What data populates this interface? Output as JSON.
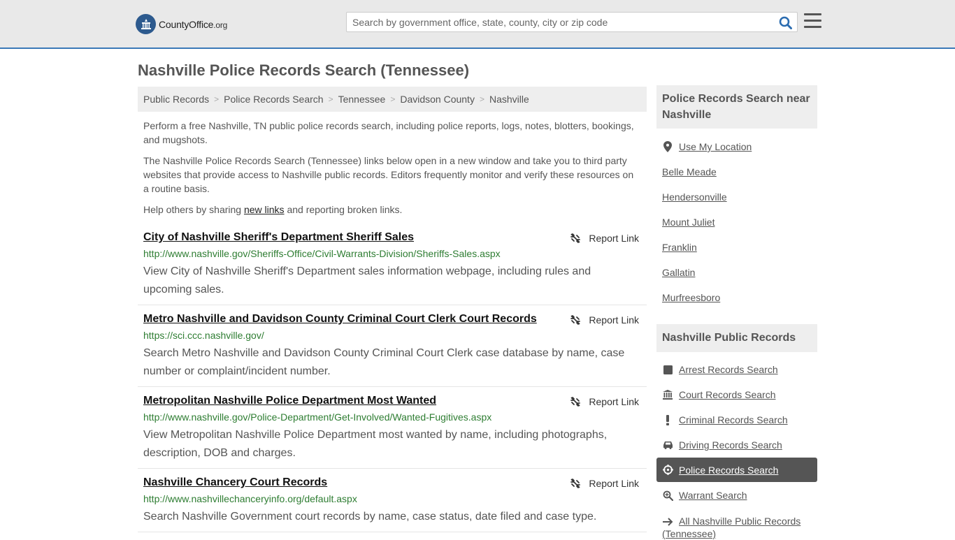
{
  "header": {
    "logo_name": "CountyOffice",
    "logo_tld": ".org",
    "search_placeholder": "Search by government office, state, county, city or zip code"
  },
  "page_title": "Nashville Police Records Search (Tennessee)",
  "breadcrumb": [
    "Public Records",
    "Police Records Search",
    "Tennessee",
    "Davidson County",
    "Nashville"
  ],
  "intro": {
    "p1": "Perform a free Nashville, TN public police records search, including police reports, logs, notes, blotters, bookings, and mugshots.",
    "p2": "The Nashville Police Records Search (Tennessee) links below open in a new window and take you to third party websites that provide access to Nashville public records. Editors frequently monitor and verify these resources on a routine basis.",
    "p3_before": "Help others by sharing ",
    "p3_link": "new links",
    "p3_after": " and reporting broken links."
  },
  "report_label": "Report Link",
  "results": [
    {
      "title": "City of Nashville Sheriff's Department Sheriff Sales",
      "url": "http://www.nashville.gov/Sheriffs-Office/Civil-Warrants-Division/Sheriffs-Sales.aspx",
      "desc": "View City of Nashville Sheriff's Department sales information webpage, including rules and upcoming sales."
    },
    {
      "title": "Metro Nashville and Davidson County Criminal Court Clerk Court Records",
      "url": "https://sci.ccc.nashville.gov/",
      "desc": "Search Metro Nashville and Davidson County Criminal Court Clerk case database by name, case number or complaint/incident number."
    },
    {
      "title": "Metropolitan Nashville Police Department Most Wanted",
      "url": "http://www.nashville.gov/Police-Department/Get-Involved/Wanted-Fugitives.aspx",
      "desc": "View Metropolitan Nashville Police Department most wanted by name, including photographs, description, DOB and charges."
    },
    {
      "title": "Nashville Chancery Court Records",
      "url": "http://www.nashvillechanceryinfo.org/default.aspx",
      "desc": "Search Nashville Government court records by name, case status, date filed and case type."
    }
  ],
  "sidebar": {
    "nearby_heading": "Police Records Search near Nashville",
    "use_location": "Use My Location",
    "nearby": [
      "Belle Meade",
      "Hendersonville",
      "Mount Juliet",
      "Franklin",
      "Gallatin",
      "Murfreesboro"
    ],
    "public_heading": "Nashville Public Records",
    "public_links": [
      {
        "label": "Arrest Records Search",
        "icon": "arrest-icon"
      },
      {
        "label": "Court Records Search",
        "icon": "courthouse-icon"
      },
      {
        "label": "Criminal Records Search",
        "icon": "exclamation-icon"
      },
      {
        "label": "Driving Records Search",
        "icon": "car-icon"
      },
      {
        "label": "Police Records Search",
        "icon": "crosshairs-icon"
      },
      {
        "label": "Warrant Search",
        "icon": "magnify-icon"
      },
      {
        "label": "All Nashville Public Records",
        "icon": "arrow-right-icon"
      }
    ],
    "all_suffix": "(Tennessee)",
    "active_color": "#555555"
  }
}
